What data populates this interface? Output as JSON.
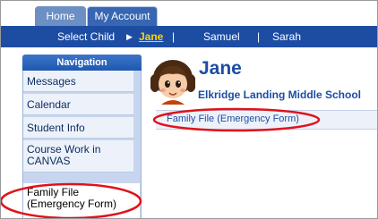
{
  "tabs": [
    {
      "label": "Home"
    },
    {
      "label": "My Account"
    }
  ],
  "child_bar": {
    "label": "Select Child",
    "children": [
      "Jane",
      "Samuel",
      "Sarah"
    ],
    "selected": "Jane",
    "separator": "|"
  },
  "navigation": {
    "header": "Navigation",
    "items": [
      {
        "label": "Messages"
      },
      {
        "label": "Calendar"
      },
      {
        "label": "Student Info"
      },
      {
        "label": "Course Work in CANVAS"
      },
      {
        "label": "Family File (Emergency Form)"
      }
    ]
  },
  "student": {
    "name": "Jane",
    "school": "Elkridge Landing Middle School"
  },
  "subnav": {
    "link": "Family File (Emergency Form)"
  },
  "colors": {
    "primary_blue": "#1d4da3",
    "selected_child": "#ffd400",
    "annotation_red": "#e0121b"
  }
}
